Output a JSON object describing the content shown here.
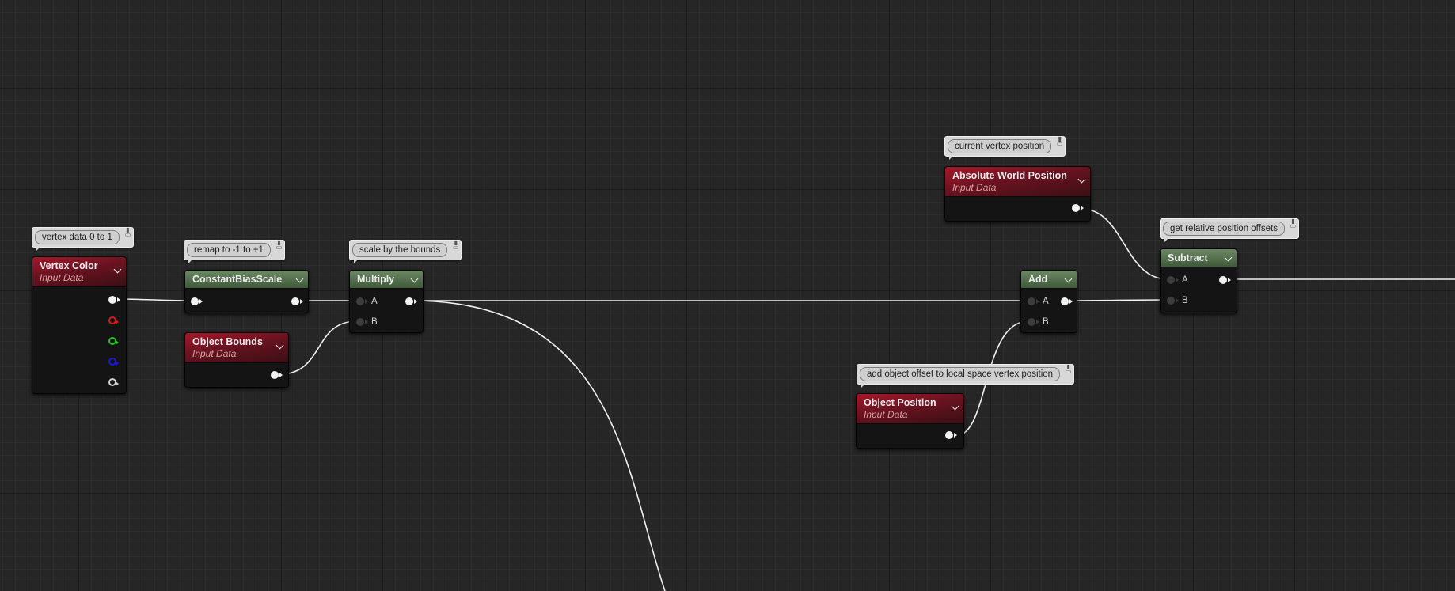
{
  "comments": {
    "vertex": "vertex data 0 to 1",
    "remap": "remap to -1 to +1",
    "scale": "scale by the bounds",
    "current": "current vertex position",
    "relative": "get relative position offsets",
    "offset": "add object offset to local space vertex position"
  },
  "nodes": {
    "vertex_color": {
      "title": "Vertex Color",
      "subtitle": "Input Data"
    },
    "constant_bias_scale": {
      "title": "ConstantBiasScale"
    },
    "object_bounds": {
      "title": "Object Bounds",
      "subtitle": "Input Data"
    },
    "multiply": {
      "title": "Multiply",
      "pin_a": "A",
      "pin_b": "B"
    },
    "absolute_world_position": {
      "title": "Absolute World Position",
      "subtitle": "Input Data"
    },
    "add": {
      "title": "Add",
      "pin_a": "A",
      "pin_b": "B"
    },
    "object_position": {
      "title": "Object Position",
      "subtitle": "Input Data"
    },
    "subtract": {
      "title": "Subtract",
      "pin_a": "A",
      "pin_b": "B"
    }
  },
  "colors": {
    "background": "#262626",
    "input_header": "#8a1726",
    "math_header": "#5a7452",
    "wire": "#f2f2f2",
    "pin_red": "#d41a1a",
    "pin_green": "#1ec81e",
    "pin_blue": "#1a1ad4",
    "pin_white": "#f2f2f2"
  }
}
